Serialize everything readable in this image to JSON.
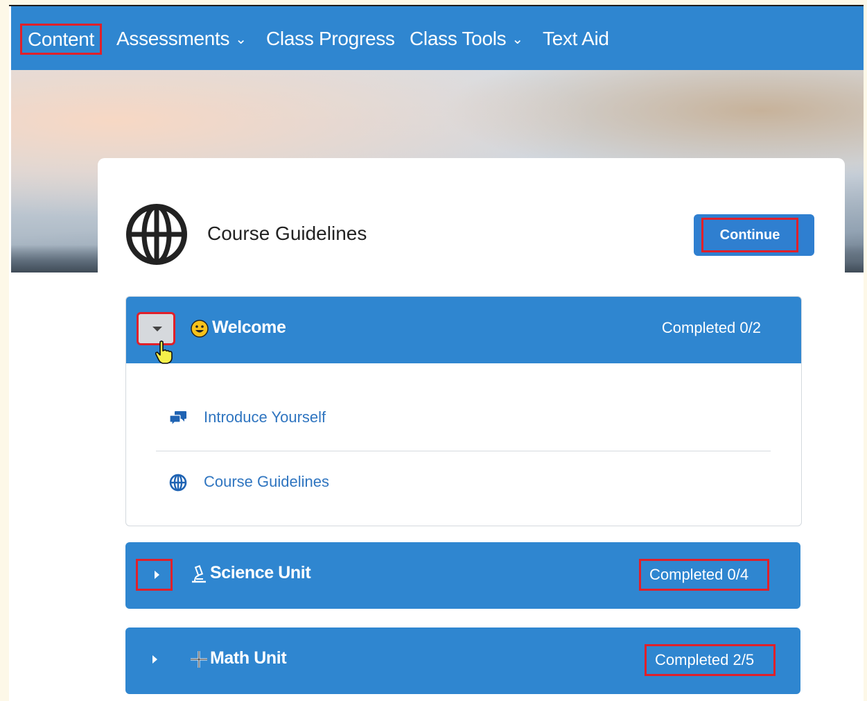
{
  "nav": {
    "items": [
      {
        "label": "Content",
        "selected": true
      },
      {
        "label": "Assessments",
        "has_dropdown": true
      },
      {
        "label": "Class Progress"
      },
      {
        "label": "Class Tools",
        "has_dropdown": true
      },
      {
        "label": "Text Aid"
      }
    ]
  },
  "hero_card": {
    "title": "Course Guidelines",
    "icon": "globe-icon",
    "continue_label": "Continue"
  },
  "modules": [
    {
      "title": "Welcome",
      "icon": "smiley-icon",
      "status": "Completed 0/2",
      "expanded": true,
      "topics": [
        {
          "label": "Introduce Yourself",
          "icon": "discussion-icon"
        },
        {
          "label": "Course Guidelines",
          "icon": "globe-icon"
        }
      ]
    },
    {
      "title": "Science Unit",
      "icon": "microscope-icon",
      "status": "Completed 0/4",
      "expanded": false
    },
    {
      "title": "Math Unit",
      "icon": "plus-icon",
      "status": "Completed 2/5",
      "expanded": false
    }
  ],
  "colors": {
    "nav_bg": "#2f86d0",
    "module_bg": "#2f86d0",
    "link": "#2f75c0",
    "highlight": "#e0202a"
  }
}
